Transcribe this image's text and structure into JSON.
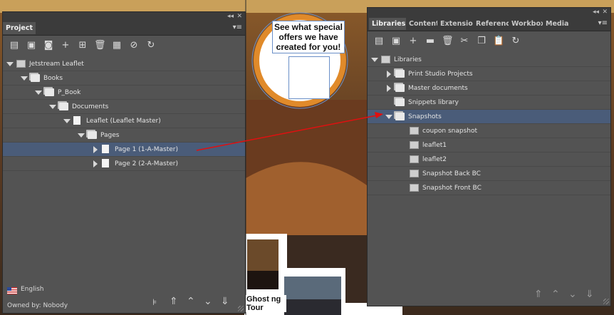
{
  "artwork": {
    "offer_text": "See what special offers we have created for you!",
    "ghost_text": "Ghost ng Tour"
  },
  "project_panel": {
    "tab": "Project",
    "toolbar_icons": [
      "checkout-icon",
      "save-icon",
      "save-version-icon",
      "add-icon",
      "add-child-icon",
      "delete-icon",
      "properties-icon",
      "unlink-icon",
      "refresh-icon"
    ],
    "tree": [
      {
        "label": "Jetstream Leaflet",
        "icon": "project-icon",
        "expanded": true,
        "level": 0
      },
      {
        "label": "Books",
        "icon": "folder-icon",
        "expanded": true,
        "level": 1
      },
      {
        "label": "P_Book",
        "icon": "book-icon",
        "expanded": true,
        "level": 2
      },
      {
        "label": "Documents",
        "icon": "folder-icon",
        "expanded": true,
        "level": 3
      },
      {
        "label": "Leaflet (Leaflet Master)",
        "icon": "document-icon",
        "expanded": true,
        "level": 4
      },
      {
        "label": "Pages",
        "icon": "folder-icon",
        "expanded": true,
        "level": 5
      },
      {
        "label": "Page 1 (1-A-Master)",
        "icon": "page-icon",
        "expanded": false,
        "level": 6,
        "selected": true
      },
      {
        "label": "Page 2 (2-A-Master)",
        "icon": "page-icon",
        "expanded": false,
        "level": 6
      }
    ],
    "language": "English",
    "owner": "Owned by: Nobody"
  },
  "libraries_panel": {
    "tabs": [
      "Libraries",
      "Content",
      "Extension",
      "Reference",
      "Workbox",
      "Media"
    ],
    "toolbar_icons": [
      "checkout-icon",
      "save-icon",
      "add-icon",
      "new-folder-icon",
      "delete-icon",
      "cut-icon",
      "copy-icon",
      "paste-icon",
      "refresh-icon"
    ],
    "tree": [
      {
        "label": "Libraries",
        "icon": "libraries-icon",
        "expanded": true,
        "level": 0
      },
      {
        "label": "Print Studio Projects",
        "icon": "folder-icon",
        "expanded": false,
        "level": 1
      },
      {
        "label": "Master documents",
        "icon": "folder-icon",
        "expanded": false,
        "level": 1
      },
      {
        "label": "Snippets library",
        "icon": "folder-icon",
        "expanded": null,
        "level": 1
      },
      {
        "label": "Snapshots",
        "icon": "folder-icon",
        "expanded": true,
        "level": 1,
        "selected": true
      },
      {
        "label": "coupon snapshot",
        "icon": "snapshot-icon",
        "level": 2
      },
      {
        "label": "leaflet1",
        "icon": "snapshot-icon",
        "level": 2
      },
      {
        "label": "leaflet2",
        "icon": "snapshot-icon",
        "level": 2
      },
      {
        "label": "Snapshot Back BC",
        "icon": "snapshot-icon",
        "level": 2
      },
      {
        "label": "Snapshot Front BC",
        "icon": "snapshot-icon",
        "level": 2
      }
    ]
  },
  "colors": {
    "panel": "#535353",
    "selection": "#4a5c79",
    "arrow": "#e01010",
    "accent_ring": "#e08a2a"
  }
}
